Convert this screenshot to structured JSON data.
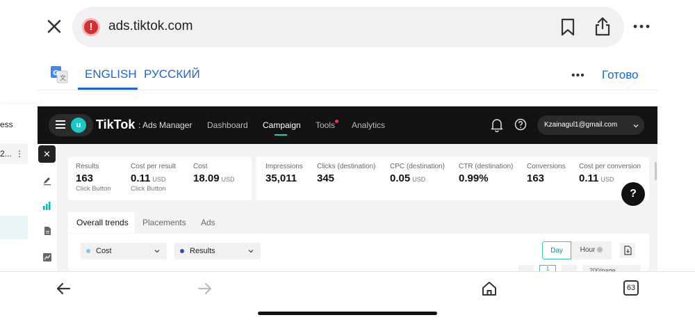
{
  "browser": {
    "url": "ads.tiktok.com",
    "tab_count": "63"
  },
  "translate": {
    "langs": [
      "ENGLISH",
      "РУССКИЙ"
    ],
    "more": "•••",
    "done": "Готово"
  },
  "left_peek": {
    "text1": "ess",
    "row": "2...",
    "dots": "⋮"
  },
  "header": {
    "avatar": "u",
    "logo": "TikTok",
    "logo_sub": ": Ads Manager",
    "nav": [
      "Dashboard",
      "Campaign",
      "Tools",
      "Analytics"
    ],
    "account": "Kzainagul1@gmail.com"
  },
  "metrics": [
    {
      "label": "Results",
      "value": "163",
      "unit": "",
      "sub": "Click Button"
    },
    {
      "label": "Cost per result",
      "value": "0.11",
      "unit": "USD",
      "sub": "Click Button"
    },
    {
      "label": "Cost",
      "value": "18.09",
      "unit": "USD",
      "sub": ""
    },
    {
      "label": "Impressions",
      "value": "35,011",
      "unit": "",
      "sub": ""
    },
    {
      "label": "Clicks (destination)",
      "value": "345",
      "unit": "",
      "sub": ""
    },
    {
      "label": "CPC (destination)",
      "value": "0.05",
      "unit": "USD",
      "sub": ""
    },
    {
      "label": "CTR (destination)",
      "value": "0.99%",
      "unit": "",
      "sub": ""
    },
    {
      "label": "Conversions",
      "value": "163",
      "unit": "",
      "sub": ""
    },
    {
      "label": "Cost per conversion",
      "value": "0.11",
      "unit": "USD",
      "sub": ""
    }
  ],
  "help_fab": "?",
  "trends": {
    "tabs": [
      "Overall trends",
      "Placements",
      "Ads"
    ],
    "dropdowns": [
      {
        "label": "Cost",
        "color": "#7ec3f0"
      },
      {
        "label": "Results",
        "color": "#3b4aa8"
      }
    ],
    "granularity": [
      "Day",
      "Hour"
    ],
    "pager_current": "1",
    "per_page": "200/page"
  },
  "colors": {
    "accent": "#1ad1c8",
    "link": "#1a66d6",
    "danger": "#d32f2f"
  }
}
